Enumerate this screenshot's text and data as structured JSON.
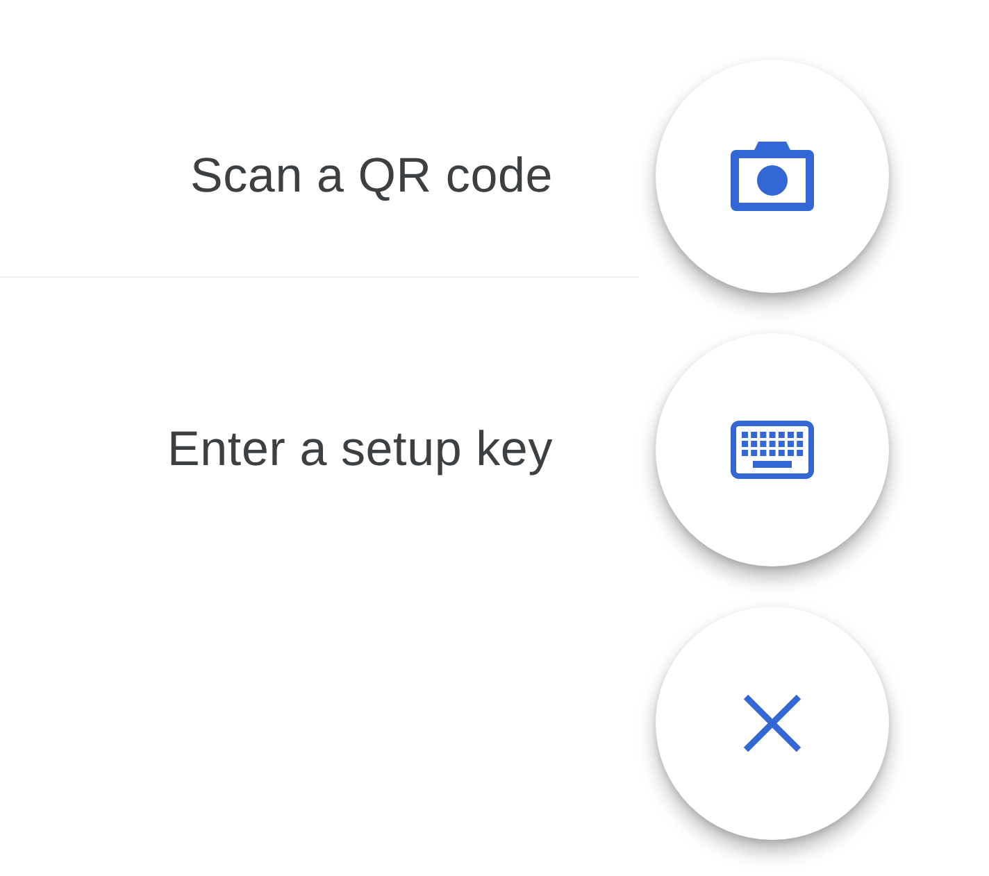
{
  "speed_dial": {
    "actions": [
      {
        "kind": "camera",
        "label": "Scan a QR code"
      },
      {
        "kind": "keyboard",
        "label": "Enter a setup key"
      }
    ],
    "close": {
      "kind": "close"
    }
  }
}
